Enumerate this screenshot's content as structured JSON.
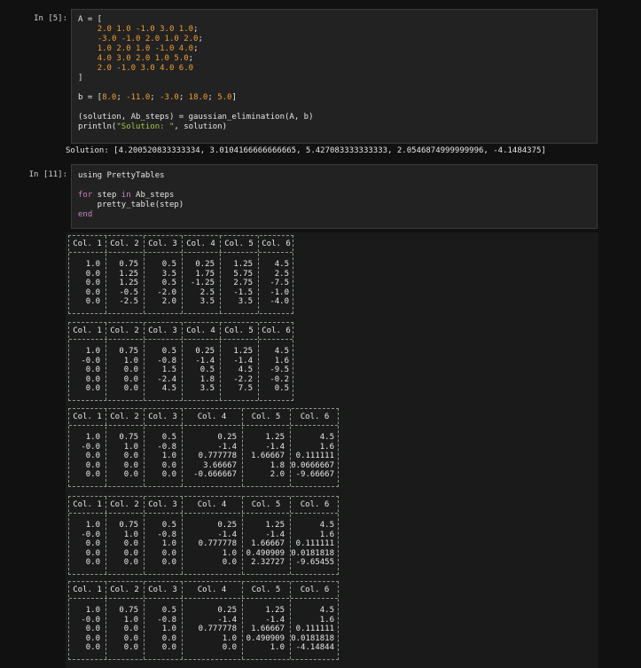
{
  "cell1": {
    "prompt": "In [5]:",
    "code": [
      [
        {
          "t": "A = [",
          "c": ""
        }
      ],
      [
        {
          "t": "    ",
          "c": ""
        },
        {
          "t": "2.0 1.0 -1.0 3.0 1.0",
          "c": "num"
        },
        {
          "t": ";",
          "c": ""
        }
      ],
      [
        {
          "t": "    ",
          "c": ""
        },
        {
          "t": "-3.0 -1.0 2.0 1.0 2.0",
          "c": "num"
        },
        {
          "t": ";",
          "c": ""
        }
      ],
      [
        {
          "t": "    ",
          "c": ""
        },
        {
          "t": "1.0 2.0 1.0 -1.0 4.0",
          "c": "num"
        },
        {
          "t": ";",
          "c": ""
        }
      ],
      [
        {
          "t": "    ",
          "c": ""
        },
        {
          "t": "4.0 3.0 2.0 1.0 5.0",
          "c": "num"
        },
        {
          "t": ";",
          "c": ""
        }
      ],
      [
        {
          "t": "    ",
          "c": ""
        },
        {
          "t": "2.0 -1.0 3.0 4.0 6.0",
          "c": "num"
        }
      ],
      [
        {
          "t": "]",
          "c": ""
        }
      ],
      [],
      [
        {
          "t": "b = [",
          "c": ""
        },
        {
          "t": "8.0",
          "c": "num"
        },
        {
          "t": "; ",
          "c": ""
        },
        {
          "t": "-11.0",
          "c": "num"
        },
        {
          "t": "; ",
          "c": ""
        },
        {
          "t": "-3.0",
          "c": "num"
        },
        {
          "t": "; ",
          "c": ""
        },
        {
          "t": "18.0",
          "c": "num"
        },
        {
          "t": "; ",
          "c": ""
        },
        {
          "t": "5.0",
          "c": "num"
        },
        {
          "t": "]",
          "c": ""
        }
      ],
      [],
      [
        {
          "t": "(solution, Ab_steps) = gaussian_elimination(A, b)",
          "c": ""
        }
      ],
      [
        {
          "t": "println(",
          "c": ""
        },
        {
          "t": "\"Solution: \"",
          "c": "str"
        },
        {
          "t": ", solution)",
          "c": ""
        }
      ]
    ],
    "output": "Solution: [4.200520833333334, 3.0104166666666665, 5.427083333333333, 2.0546874999999996, -4.1484375]"
  },
  "cell2": {
    "prompt": "In [11]:",
    "code": [
      [
        {
          "t": "using PrettyTables",
          "c": ""
        }
      ],
      [],
      [
        {
          "t": "for",
          "c": "kw"
        },
        {
          "t": " step ",
          "c": ""
        },
        {
          "t": "in",
          "c": "kw"
        },
        {
          "t": " Ab_steps",
          "c": ""
        }
      ],
      [
        {
          "t": "    pretty_table(step)",
          "c": ""
        }
      ],
      [
        {
          "t": "end",
          "c": "kw"
        }
      ]
    ]
  },
  "tables": [
    {
      "headers": [
        "Col. 1",
        "Col. 2",
        "Col. 3",
        "Col. 4",
        "Col. 5",
        "Col. 6"
      ],
      "rows": [
        [
          "1.0",
          "0.75",
          "0.5",
          "0.25",
          "1.25",
          "4.5"
        ],
        [
          "0.0",
          "1.25",
          "3.5",
          "1.75",
          "5.75",
          "2.5"
        ],
        [
          "0.0",
          "1.25",
          "0.5",
          "-1.25",
          "2.75",
          "-7.5"
        ],
        [
          "0.0",
          "-0.5",
          "-2.0",
          "2.5",
          "-1.5",
          "-1.0"
        ],
        [
          "0.0",
          "-2.5",
          "2.0",
          "3.5",
          "3.5",
          "-4.0"
        ]
      ]
    },
    {
      "headers": [
        "Col. 1",
        "Col. 2",
        "Col. 3",
        "Col. 4",
        "Col. 5",
        "Col. 6"
      ],
      "rows": [
        [
          "1.0",
          "0.75",
          "0.5",
          "0.25",
          "1.25",
          "4.5"
        ],
        [
          "-0.0",
          "1.0",
          "-0.8",
          "-1.4",
          "-1.4",
          "1.6"
        ],
        [
          "0.0",
          "0.0",
          "1.5",
          "0.5",
          "4.5",
          "-9.5"
        ],
        [
          "0.0",
          "0.0",
          "-2.4",
          "1.8",
          "-2.2",
          "-0.2"
        ],
        [
          "0.0",
          "0.0",
          "4.5",
          "3.5",
          "7.5",
          "0.5"
        ]
      ]
    },
    {
      "headers": [
        "Col. 1",
        "Col. 2",
        "Col. 3",
        "Col. 4",
        "Col. 5",
        "Col. 6"
      ],
      "rows": [
        [
          "1.0",
          "0.75",
          "0.5",
          "0.25",
          "1.25",
          "4.5"
        ],
        [
          "-0.0",
          "1.0",
          "-0.8",
          "-1.4",
          "-1.4",
          "1.6"
        ],
        [
          "0.0",
          "0.0",
          "1.0",
          "0.777778",
          "1.66667",
          "0.111111"
        ],
        [
          "0.0",
          "0.0",
          "0.0",
          "3.66667",
          "1.8",
          "0.0666667"
        ],
        [
          "0.0",
          "0.0",
          "0.0",
          "-0.666667",
          "2.0",
          "-9.66667"
        ]
      ]
    },
    {
      "headers": [
        "Col. 1",
        "Col. 2",
        "Col. 3",
        "Col. 4",
        "Col. 5",
        "Col. 6"
      ],
      "rows": [
        [
          "1.0",
          "0.75",
          "0.5",
          "0.25",
          "1.25",
          "4.5"
        ],
        [
          "-0.0",
          "1.0",
          "-0.8",
          "-1.4",
          "-1.4",
          "1.6"
        ],
        [
          "0.0",
          "0.0",
          "1.0",
          "0.777778",
          "1.66667",
          "0.111111"
        ],
        [
          "0.0",
          "0.0",
          "0.0",
          "1.0",
          "0.490909",
          "0.0181818"
        ],
        [
          "0.0",
          "0.0",
          "0.0",
          "0.0",
          "2.32727",
          "-9.65455"
        ]
      ]
    },
    {
      "headers": [
        "Col. 1",
        "Col. 2",
        "Col. 3",
        "Col. 4",
        "Col. 5",
        "Col. 6"
      ],
      "rows": [
        [
          "1.0",
          "0.75",
          "0.5",
          "0.25",
          "1.25",
          "4.5"
        ],
        [
          "-0.0",
          "1.0",
          "-0.8",
          "-1.4",
          "-1.4",
          "1.6"
        ],
        [
          "0.0",
          "0.0",
          "1.0",
          "0.777778",
          "1.66667",
          "0.111111"
        ],
        [
          "0.0",
          "0.0",
          "0.0",
          "1.0",
          "0.490909",
          "0.0181818"
        ],
        [
          "0.0",
          "0.0",
          "0.0",
          "0.0",
          "1.0",
          "-4.14844"
        ]
      ]
    }
  ]
}
